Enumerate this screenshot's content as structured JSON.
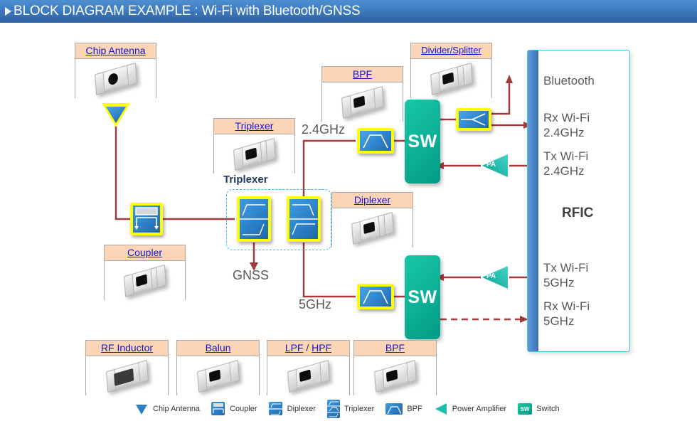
{
  "title": {
    "marker": "▶",
    "text": "BLOCK DIAGRAM EXAMPLE : Wi-Fi with Bluetooth/GNSS"
  },
  "cards": [
    {
      "name": "chip-antenna",
      "label": "Chip Antenna"
    },
    {
      "name": "triplexer",
      "label": "Triplexer"
    },
    {
      "name": "bpf-top",
      "label": "BPF"
    },
    {
      "name": "divider-splitter",
      "label": "Divider/Splitter"
    },
    {
      "name": "coupler",
      "label": "Coupler"
    },
    {
      "name": "diplexer",
      "label": "Diplexer"
    },
    {
      "name": "rf-inductor",
      "label": "RF Inductor"
    },
    {
      "name": "balun",
      "label": "Balun"
    },
    {
      "name": "lpf-hpf",
      "label": "LPF / HPF"
    },
    {
      "name": "bpf-bottom",
      "label": "BPF"
    }
  ],
  "diagram": {
    "group_label": "Triplexer",
    "gnss_label": "GNSS",
    "band_24": "2.4GHz",
    "band_5": "5GHz",
    "switch_label": "SW",
    "pa_label": "PA"
  },
  "rfic": {
    "title": "RFIC",
    "ports": [
      "Bluetooth",
      "Rx Wi-Fi\n2.4GHz",
      "Tx Wi-Fi\n2.4GHz",
      "Tx Wi-Fi\n5GHz",
      "Rx Wi-Fi\n5GHz"
    ],
    "port_bluetooth": "Bluetooth",
    "port_rx24_l1": "Rx Wi-Fi",
    "port_rx24_l2": "2.4GHz",
    "port_tx24_l1": "Tx Wi-Fi",
    "port_tx24_l2": "2.4GHz",
    "port_tx5_l1": "Tx Wi-Fi",
    "port_tx5_l2": "5GHz",
    "port_rx5_l1": "Rx Wi-Fi",
    "port_rx5_l2": "5GHz"
  },
  "legend": [
    {
      "icon": "chip-antenna-icon",
      "label": "Chip Antenna"
    },
    {
      "icon": "coupler-icon",
      "label": "Coupler"
    },
    {
      "icon": "diplexer-icon",
      "label": "Diplexer"
    },
    {
      "icon": "triplexer-icon",
      "label": "Triplexer"
    },
    {
      "icon": "bpf-icon",
      "label": "BPF"
    },
    {
      "icon": "power-amplifier-icon",
      "label": "Power Amplifier"
    },
    {
      "icon": "switch-icon",
      "label": "Switch"
    }
  ],
  "colors": {
    "title_bar": "#3f7dc2",
    "card_header": "#fbd5b5",
    "card_header_text": "#1414d0",
    "symbol_blue": "#2f86cf",
    "symbol_outline": "#ffff00",
    "switch_teal": "#10b79b",
    "wire_red": "#a33a3a",
    "rfic_border": "#49c3f0",
    "rfic_bar": "#4a84c4",
    "group_dash": "#2ec0f0",
    "text_gray": "#595959"
  }
}
